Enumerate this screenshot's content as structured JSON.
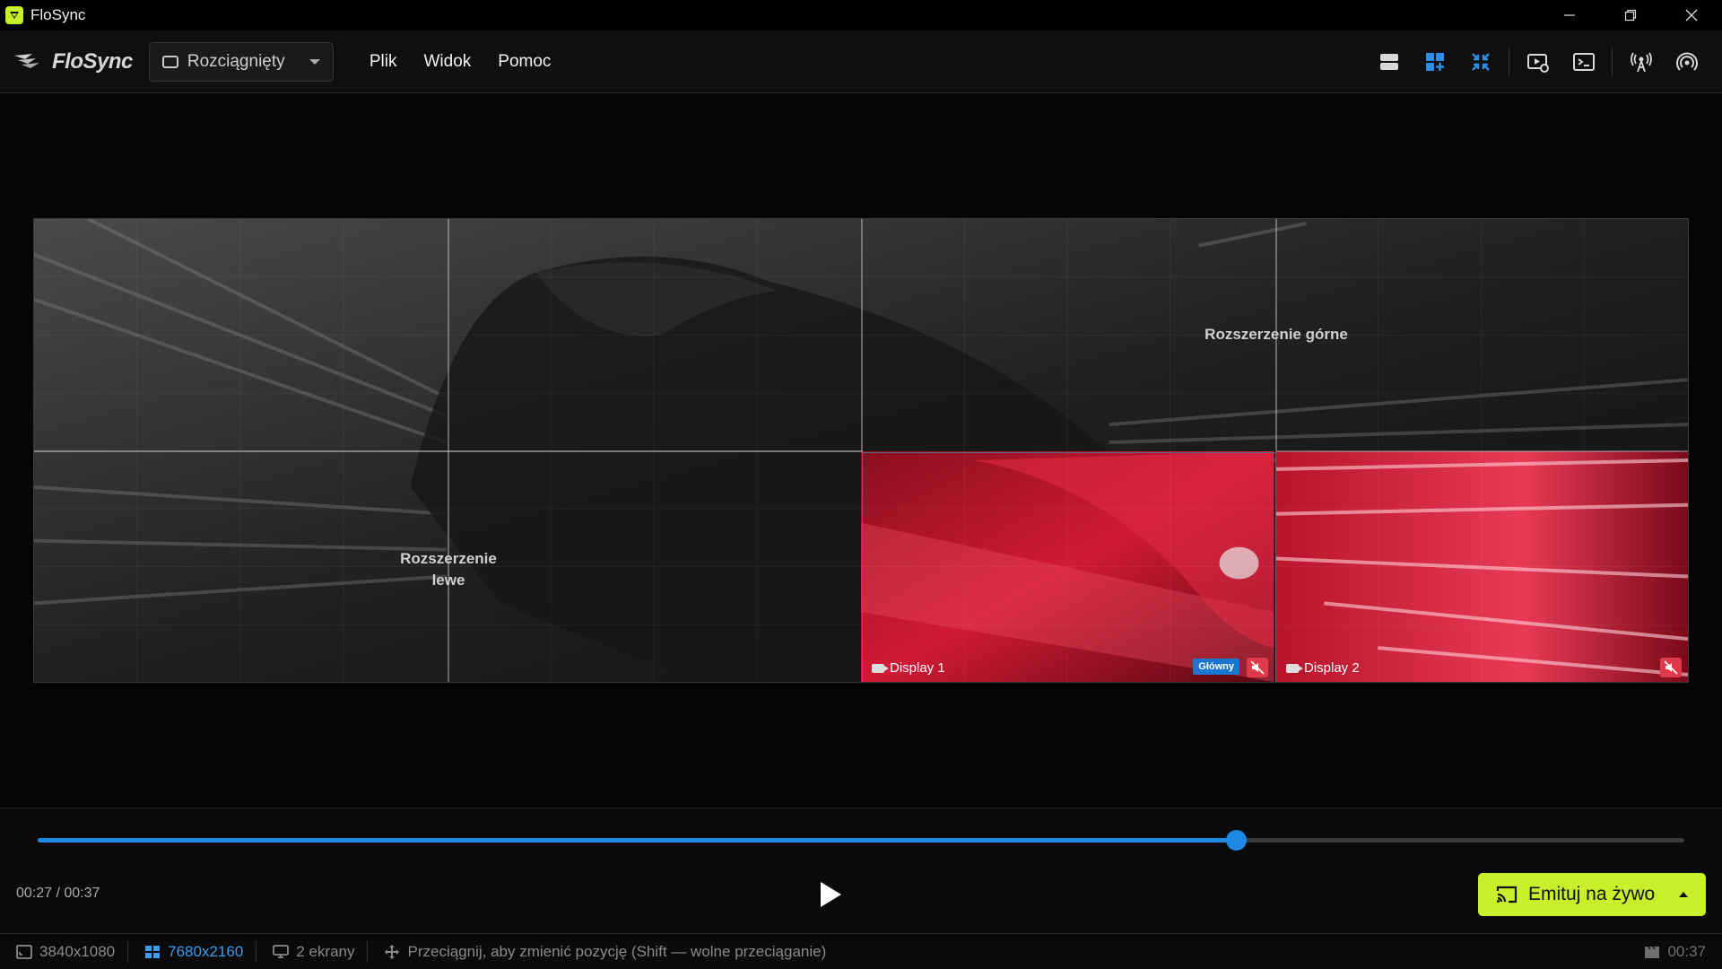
{
  "window": {
    "title": "FloSync"
  },
  "toolbar": {
    "logo_text": "FloSync",
    "mode_select": "Rozciągnięty",
    "menu": [
      "Plik",
      "Widok",
      "Pomoc"
    ],
    "tools": [
      {
        "name": "rows-layout-icon",
        "active": false
      },
      {
        "name": "grid-add-icon",
        "active": true
      },
      {
        "name": "compress-icon",
        "active": true
      },
      {
        "name": "preview-settings-icon",
        "active": false
      },
      {
        "name": "terminal-icon",
        "active": false
      },
      {
        "name": "broadcast-icon",
        "active": false
      },
      {
        "name": "signal-icon",
        "active": false
      }
    ]
  },
  "canvas": {
    "ext_top": "Rozszerzenie górne",
    "ext_left_line1": "Rozszerzenie",
    "ext_left_line2": "lewe",
    "displays": [
      {
        "name": "Display 1",
        "badge": "Główny",
        "muted": true
      },
      {
        "name": "Display 2",
        "muted": true
      }
    ]
  },
  "player": {
    "time": "00:27 / 00:37",
    "progress": 0.7275,
    "live_label": "Emituj na żywo"
  },
  "status": {
    "resolution": "3840x1080",
    "canvas_res": "7680x2160",
    "screens": "2 ekrany",
    "hint": "Przeciągnij, aby zmienić pozycję (Shift — wolne przeciąganie)",
    "duration": "00:37"
  },
  "colors": {
    "accent": "#c8f02a",
    "blue": "#1e88e5"
  }
}
